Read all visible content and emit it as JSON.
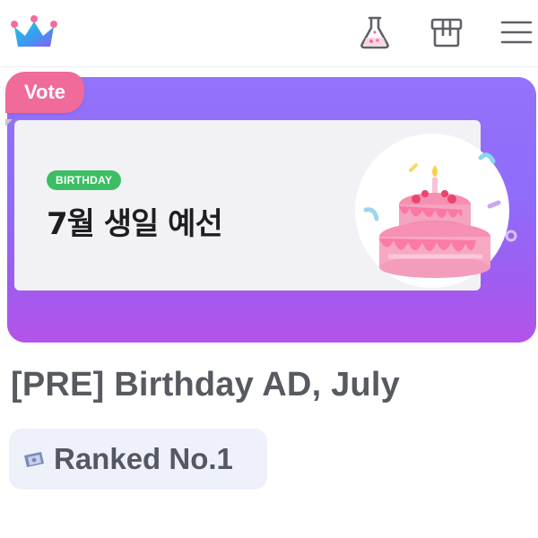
{
  "header": {
    "logo_icon": "crown-icon",
    "buttons": [
      {
        "icon": "flask-icon"
      },
      {
        "icon": "store-icon"
      },
      {
        "icon": "menu-icon"
      }
    ]
  },
  "banner": {
    "tag_label": "Vote",
    "badge_label": "BIRTHDAY",
    "title": "7월 생일 예선",
    "image_icon": "birthday-cake-icon",
    "colors": {
      "gradient_top": "#9472fb",
      "gradient_bottom": "#b453e9",
      "tag": "#f06a9a",
      "badge": "#3dbd64"
    }
  },
  "event": {
    "title": "[PRE] Birthday AD, July",
    "rank_icon": "ticket-icon",
    "rank_label": "Ranked No.1"
  }
}
